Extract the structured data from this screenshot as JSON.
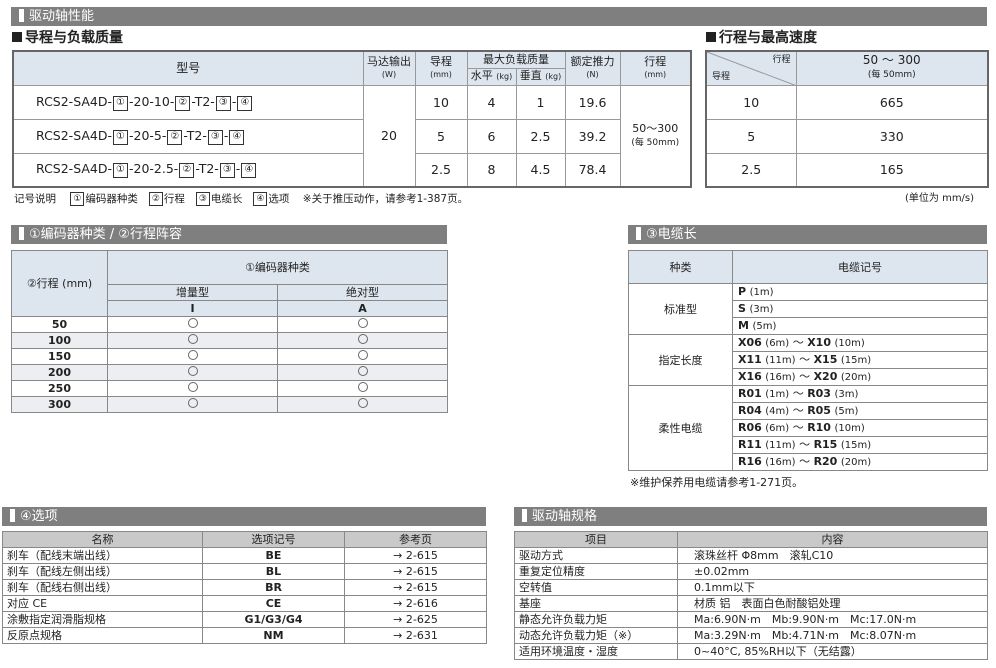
{
  "page_title": "驱动轴性能",
  "lead_section": {
    "title": "导程与负载质量",
    "headers": {
      "model": "型号",
      "motor": "马达输出",
      "motor_unit": "(W)",
      "lead": "导程",
      "lead_unit": "(mm)",
      "max_load": "最大负载质量",
      "horizontal": "水平",
      "vertical": "垂直",
      "kg": "(kg)",
      "thrust": "额定推力",
      "thrust_unit": "(N)",
      "stroke": "行程",
      "stroke_unit": "(mm)"
    },
    "rows": [
      {
        "model_prefix": "RCS2-SA4D-",
        "model_mid": "-20-10-",
        "lead": "10",
        "horizontal": "4",
        "vertical": "1",
        "thrust": "19.6"
      },
      {
        "model_prefix": "RCS2-SA4D-",
        "model_mid": "-20-5-",
        "lead": "5",
        "horizontal": "6",
        "vertical": "2.5",
        "thrust": "39.2"
      },
      {
        "model_prefix": "RCS2-SA4D-",
        "model_mid": "-20-2.5-",
        "lead": "2.5",
        "horizontal": "8",
        "vertical": "4.5",
        "thrust": "78.4"
      }
    ],
    "model_t2": "-T2-",
    "model_dash": "-",
    "motor_value": "20",
    "stroke_value": "50～300",
    "stroke_note": "(每 50mm)",
    "box1": "①",
    "box2": "②",
    "box3": "③",
    "box4": "④"
  },
  "legend": {
    "label": "记号说明",
    "items": [
      {
        "box": "①",
        "text": "编码器种类"
      },
      {
        "box": "②",
        "text": "行程"
      },
      {
        "box": "③",
        "text": "电缆长"
      },
      {
        "box": "④",
        "text": "选项"
      }
    ],
    "note": "※关于推压动作，请参考1-387页。"
  },
  "speed_section": {
    "title": "行程与最高速度",
    "corner_top": "行程",
    "corner_bottom": "导程",
    "stroke_range": "50 ～ 300",
    "stroke_note": "(每 50mm)",
    "rows": [
      {
        "lead": "10",
        "speed": "665"
      },
      {
        "lead": "5",
        "speed": "330"
      },
      {
        "lead": "2.5",
        "speed": "165"
      }
    ],
    "unit_note": "(单位为 mm/s)"
  },
  "encoder_section": {
    "title": "①编码器种类 / ②行程阵容",
    "stroke_header": "②行程 (mm)",
    "encoder_header": "①编码器种类",
    "inc": "增量型",
    "inc_code": "I",
    "abs": "绝对型",
    "abs_code": "A",
    "strokes": [
      "50",
      "100",
      "150",
      "200",
      "250",
      "300"
    ]
  },
  "cable_section": {
    "title": "③电缆长",
    "h_type": "种类",
    "h_code": "电缆记号",
    "standard": "标准型",
    "specified": "指定长度",
    "flexible": "柔性电缆",
    "std_rows": [
      {
        "code": "P",
        "len": "(1m)"
      },
      {
        "code": "S",
        "len": "(3m)"
      },
      {
        "code": "M",
        "len": "(5m)"
      }
    ],
    "spec_rows": [
      {
        "a": "X06",
        "al": "(6m)",
        "b": "X10",
        "bl": "(10m)"
      },
      {
        "a": "X11",
        "al": "(11m)",
        "b": "X15",
        "bl": "(15m)"
      },
      {
        "a": "X16",
        "al": "(16m)",
        "b": "X20",
        "bl": "(20m)"
      }
    ],
    "flex_rows": [
      {
        "a": "R01",
        "al": "(1m)",
        "b": "R03",
        "bl": "(3m)"
      },
      {
        "a": "R04",
        "al": "(4m)",
        "b": "R05",
        "bl": "(5m)"
      },
      {
        "a": "R06",
        "al": "(6m)",
        "b": "R10",
        "bl": "(10m)"
      },
      {
        "a": "R11",
        "al": "(11m)",
        "b": "R15",
        "bl": "(15m)"
      },
      {
        "a": "R16",
        "al": "(16m)",
        "b": "R20",
        "bl": "(20m)"
      }
    ],
    "tilde": "～",
    "note": "※维护保养用电缆请参考1-271页。"
  },
  "option_section": {
    "title": "④选项",
    "headers": {
      "name": "名称",
      "code": "选项记号",
      "page": "参考页"
    },
    "rows": [
      {
        "name": "刹车（配线末端出线）",
        "code": "BE",
        "page": "→ 2-615"
      },
      {
        "name": "刹车（配线左侧出线）",
        "code": "BL",
        "page": "→ 2-615"
      },
      {
        "name": "刹车（配线右侧出线）",
        "code": "BR",
        "page": "→ 2-615"
      },
      {
        "name": "对应 CE",
        "code": "CE",
        "page": "→ 2-616"
      },
      {
        "name": "涂敷指定润滑脂规格",
        "code": "G1/G3/G4",
        "page": "→ 2-625"
      },
      {
        "name": "反原点规格",
        "code": "NM",
        "page": "→ 2-631"
      }
    ]
  },
  "spec_section": {
    "title": "驱动轴规格",
    "headers": {
      "item": "项目",
      "content": "内容"
    },
    "rows": [
      {
        "item": "驱动方式",
        "content": "滚珠丝杆 Φ8mm　滚轧C10"
      },
      {
        "item": "重复定位精度",
        "content": "±0.02mm"
      },
      {
        "item": "空转值",
        "content": "0.1mm以下"
      },
      {
        "item": "基座",
        "content": "材质 铝　表面白色耐酸铝处理"
      },
      {
        "item": "静态允许负载力矩",
        "content": "Ma:6.90N·m　Mb:9.90N·m　Mc:17.0N·m"
      },
      {
        "item": "动态允许负载力矩（※）",
        "content": "Ma:3.29N·m　Mb:4.71N·m　Mc:8.07N·m"
      },
      {
        "item": "适用环境温度・湿度",
        "content": "0~40°C, 85%RH以下（无结露）"
      }
    ]
  }
}
